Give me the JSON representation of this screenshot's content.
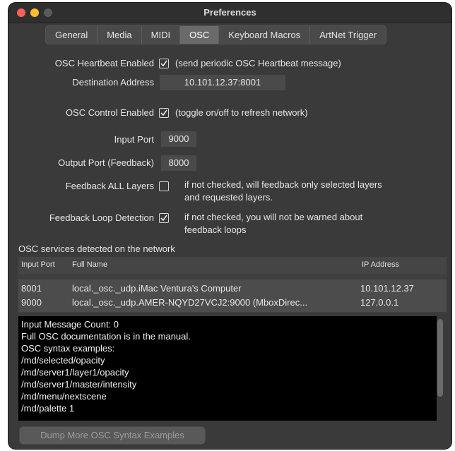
{
  "window": {
    "title": "Preferences"
  },
  "tabs": [
    {
      "label": "General"
    },
    {
      "label": "Media"
    },
    {
      "label": "MIDI"
    },
    {
      "label": "OSC"
    },
    {
      "label": "Keyboard Macros"
    },
    {
      "label": "ArtNet Trigger"
    }
  ],
  "osc": {
    "heartbeat_label": "OSC Heartbeat Enabled",
    "heartbeat_checked": true,
    "heartbeat_note": "(send periodic OSC Heartbeat message)",
    "destination_label": "Destination Address",
    "destination_value": "10.101.12.37:8001",
    "control_label": "OSC Control Enabled",
    "control_checked": true,
    "control_note": "(toggle on/off to refresh network)",
    "input_port_label": "Input Port",
    "input_port_value": "9000",
    "output_port_label": "Output Port (Feedback)",
    "output_port_value": "8000",
    "feedback_all_label": "Feedback ALL Layers",
    "feedback_all_checked": false,
    "feedback_all_note_1": "if not checked, will feedback only selected layers",
    "feedback_all_note_2": "and requested layers.",
    "loop_label": "Feedback Loop Detection",
    "loop_checked": true,
    "loop_note_1": "if not checked, you will not be warned about",
    "loop_note_2": "feedback loops"
  },
  "services": {
    "title": "OSC services detected on the network",
    "columns": {
      "port": "Input Port",
      "name": "Full Name",
      "ip": "IP Address"
    },
    "rows": [
      {
        "port": "8001",
        "name": "local._osc._udp.iMac Ventura's Computer",
        "ip": "10.101.12.37"
      },
      {
        "port": "9000",
        "name": "local._osc._udp.AMER-NQYD27VCJ2:9000 (MboxDirec...",
        "ip": "127.0.0.1"
      }
    ]
  },
  "console": {
    "lines": [
      "Input Message Count: 0",
      "Full OSC documentation is in the manual.",
      "OSC syntax examples:",
      "/md/selected/opacity",
      "/md/server1/layer1/opacity",
      "/md/server1/master/intensity",
      "/md/menu/nextscene",
      "/md/palette 1"
    ]
  },
  "buttons": {
    "dump": "Dump More OSC Syntax Examples"
  },
  "colors": {
    "window_bg": "#3a3a3a",
    "console_bg": "#000000",
    "close": "#fe5f57",
    "minimize": "#febc2e"
  }
}
